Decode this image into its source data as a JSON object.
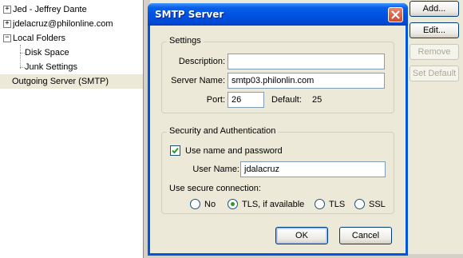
{
  "tree": {
    "accounts": [
      {
        "label": "Jed - Jeffrey Dante",
        "expander": "+"
      },
      {
        "label": "jdelacruz@philonline.com",
        "expander": "+"
      },
      {
        "label": "Local Folders",
        "expander": "−"
      }
    ],
    "local_children": [
      "Disk Space",
      "Junk Settings"
    ],
    "outgoing": "Outgoing Server (SMTP)"
  },
  "side_buttons": {
    "add": "Add...",
    "edit": "Edit...",
    "remove": "Remove",
    "set_default": "Set Default"
  },
  "dialog": {
    "title": "SMTP Server",
    "settings": {
      "group_title": "Settings",
      "description_label": "Description:",
      "description_value": "",
      "server_label": "Server Name:",
      "server_value": "smtp03.philonlin.com",
      "port_label": "Port:",
      "port_value": "26",
      "default_label": "Default:",
      "default_value": "25"
    },
    "security": {
      "group_title": "Security and Authentication",
      "use_name_label": "Use name and password",
      "use_name_checked": true,
      "username_label": "User Name:",
      "username_value": "jdalacruz",
      "secure_label": "Use secure connection:",
      "options": [
        {
          "label": "No",
          "selected": false
        },
        {
          "label": "TLS, if available",
          "selected": true
        },
        {
          "label": "TLS",
          "selected": false
        },
        {
          "label": "SSL",
          "selected": false
        }
      ]
    },
    "ok_label": "OK",
    "cancel_label": "Cancel"
  }
}
